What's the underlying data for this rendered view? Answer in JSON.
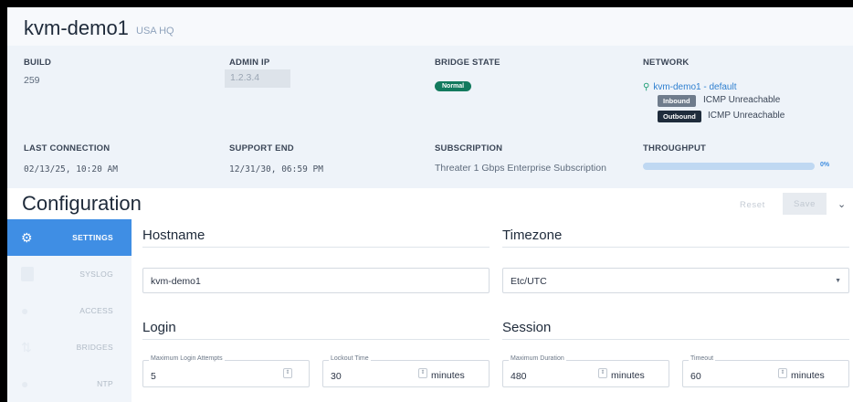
{
  "header": {
    "title": "kvm-demo1",
    "subtitle": "USA HQ",
    "build": {
      "label": "BUILD",
      "value": "259"
    },
    "admin_ip": {
      "label": "ADMIN IP",
      "value": "1.2.3.4"
    },
    "bridge_state": {
      "label": "BRIDGE STATE",
      "value": "Normal"
    },
    "network": {
      "label": "NETWORK",
      "link": "kvm-demo1 - default",
      "inbound": {
        "badge": "Inbound",
        "text": "ICMP Unreachable"
      },
      "outbound": {
        "badge": "Outbound",
        "text": "ICMP Unreachable"
      }
    },
    "last_connection": {
      "label": "LAST CONNECTION",
      "value": "02/13/25, 10:20 AM"
    },
    "support_end": {
      "label": "SUPPORT END",
      "value": "12/31/30, 06:59 PM"
    },
    "subscription": {
      "label": "SUBSCRIPTION",
      "value": "Threater 1 Gbps Enterprise Subscription"
    },
    "throughput": {
      "label": "THROUGHPUT",
      "percent_text": "0%",
      "fraction": 0.0
    }
  },
  "config": {
    "title": "Configuration",
    "reset_label": "Reset",
    "save_label": "Save"
  },
  "sidebar": {
    "items": [
      {
        "label": "SETTINGS",
        "icon": "gear-icon",
        "active": true
      },
      {
        "label": "SYSLOG",
        "icon": "document-icon",
        "active": false
      },
      {
        "label": "ACCESS",
        "icon": "users-icon",
        "active": false
      },
      {
        "label": "BRIDGES",
        "icon": "bridge-icon",
        "active": false
      },
      {
        "label": "NTP",
        "icon": "clock-icon",
        "active": false
      }
    ]
  },
  "form": {
    "hostname": {
      "heading": "Hostname",
      "value": "kvm-demo1"
    },
    "timezone": {
      "heading": "Timezone",
      "value": "Etc/UTC"
    },
    "login": {
      "heading": "Login",
      "max_attempts": {
        "label": "Maximum Login Attempts",
        "value": "5"
      },
      "lockout": {
        "label": "Lockout Time",
        "value": "30",
        "unit": "minutes"
      }
    },
    "session": {
      "heading": "Session",
      "max_duration": {
        "label": "Maximum Duration",
        "value": "480",
        "unit": "minutes"
      },
      "timeout": {
        "label": "Timeout",
        "value": "60",
        "unit": "minutes"
      }
    }
  },
  "colors": {
    "accent": "#3f8ee4",
    "status_normal": "#137a5e",
    "header_bg": "#eef3f9"
  }
}
